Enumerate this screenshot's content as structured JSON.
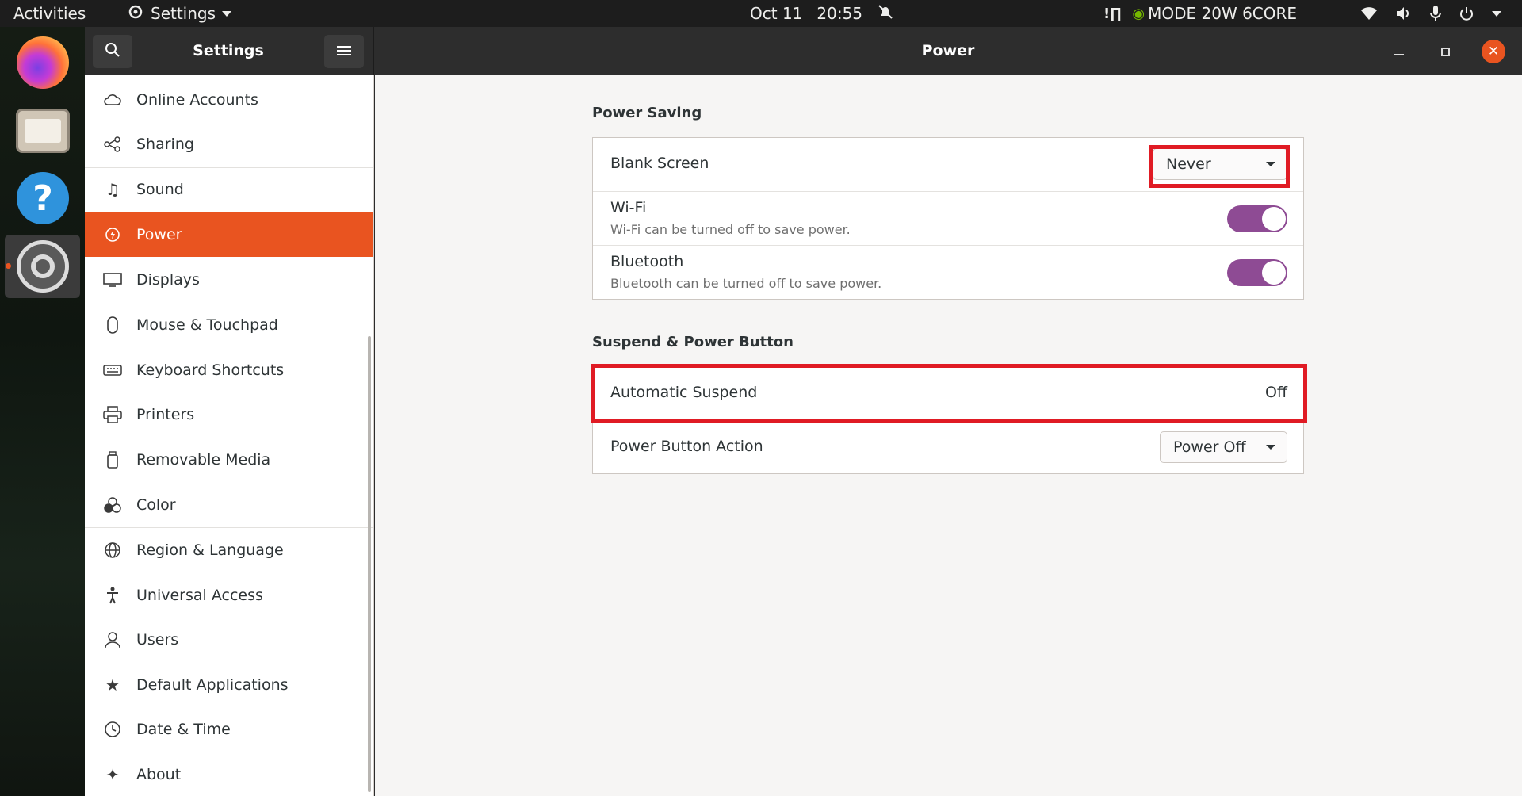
{
  "topbar": {
    "activities": "Activities",
    "app_menu": "Settings",
    "date": "Oct 11",
    "time": "20:55",
    "gpu_mode": "MODE 20W 6CORE"
  },
  "dock": {
    "apps": [
      "firefox-icon",
      "files-icon",
      "help-icon",
      "settings-icon"
    ]
  },
  "headerbar": {
    "sidebar_title": "Settings",
    "page_title": "Power"
  },
  "sidebar": {
    "items": [
      {
        "label": "Online Accounts",
        "icon": "cloud-icon"
      },
      {
        "label": "Sharing",
        "icon": "share-icon"
      },
      {
        "label": "Sound",
        "icon": "music-note-icon"
      },
      {
        "label": "Power",
        "icon": "power-icon",
        "active": true
      },
      {
        "label": "Displays",
        "icon": "display-icon"
      },
      {
        "label": "Mouse & Touchpad",
        "icon": "mouse-icon"
      },
      {
        "label": "Keyboard Shortcuts",
        "icon": "keyboard-icon"
      },
      {
        "label": "Printers",
        "icon": "printer-icon"
      },
      {
        "label": "Removable Media",
        "icon": "removable-media-icon"
      },
      {
        "label": "Color",
        "icon": "color-icon"
      },
      {
        "label": "Region & Language",
        "icon": "globe-icon"
      },
      {
        "label": "Universal Access",
        "icon": "accessibility-icon"
      },
      {
        "label": "Users",
        "icon": "users-icon"
      },
      {
        "label": "Default Applications",
        "icon": "star-icon"
      },
      {
        "label": "Date & Time",
        "icon": "clock-icon"
      },
      {
        "label": "About",
        "icon": "sparkle-icon"
      }
    ]
  },
  "power_saving": {
    "title": "Power Saving",
    "blank_screen": {
      "label": "Blank Screen",
      "value": "Never"
    },
    "wifi": {
      "label": "Wi-Fi",
      "description": "Wi-Fi can be turned off to save power.",
      "enabled": true
    },
    "bluetooth": {
      "label": "Bluetooth",
      "description": "Bluetooth can be turned off to save power.",
      "enabled": true
    }
  },
  "suspend": {
    "title": "Suspend & Power Button",
    "automatic_suspend": {
      "label": "Automatic Suspend",
      "value": "Off"
    },
    "power_button_action": {
      "label": "Power Button Action",
      "value": "Power Off"
    }
  },
  "colors": {
    "accent": "#e95420",
    "toggle_on": "#8e4b94",
    "highlight": "#e01b24"
  }
}
